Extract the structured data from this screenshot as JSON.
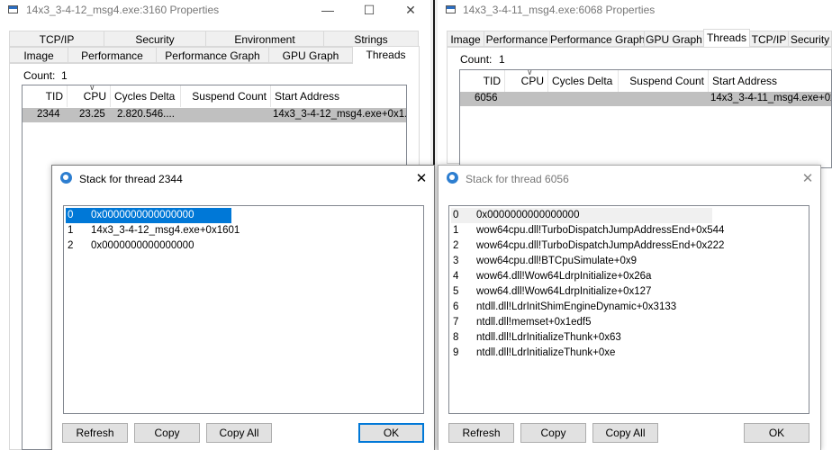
{
  "left_window": {
    "title": "14x3_3-4-12_msg4.exe:3160 Properties",
    "tabs_row1": [
      "TCP/IP",
      "Security",
      "Environment",
      "Strings"
    ],
    "tabs_row2": [
      "Image",
      "Performance",
      "Performance Graph",
      "GPU Graph",
      "Threads"
    ],
    "active_tab": "Threads",
    "count_label": "Count:",
    "count_value": "1",
    "columns": [
      "TID",
      "CPU",
      "Cycles Delta",
      "Suspend Count",
      "Start Address"
    ],
    "row": {
      "tid": "2344",
      "cpu": "23.25",
      "cycles": "2.820.546....",
      "suspend": "",
      "start": "14x3_3-4-12_msg4.exe+0x1..."
    }
  },
  "right_window": {
    "title": "14x3_3-4-11_msg4.exe:6068 Properties",
    "tabs": [
      "Image",
      "Performance",
      "Performance Graph",
      "GPU Graph",
      "Threads",
      "TCP/IP",
      "Security"
    ],
    "active_tab": "Threads",
    "count_label": "Count:",
    "count_value": "1",
    "columns": [
      "TID",
      "CPU",
      "Cycles Delta",
      "Suspend Count",
      "Start Address"
    ],
    "row": {
      "tid": "6056",
      "cpu": "",
      "cycles": "",
      "suspend": "",
      "start": "14x3_3-4-11_msg4.exe+0x1..."
    }
  },
  "left_dialog": {
    "title": "Stack for thread 2344",
    "frames": [
      {
        "n": "0",
        "addr": "0x0000000000000000"
      },
      {
        "n": "1",
        "addr": "14x3_3-4-12_msg4.exe+0x1601"
      },
      {
        "n": "2",
        "addr": "0x0000000000000000"
      }
    ],
    "buttons": {
      "refresh": "Refresh",
      "copy": "Copy",
      "copy_all": "Copy All",
      "ok": "OK"
    }
  },
  "right_dialog": {
    "title": "Stack for thread 6056",
    "frames": [
      {
        "n": "0",
        "addr": "0x0000000000000000"
      },
      {
        "n": "1",
        "addr": "wow64cpu.dll!TurboDispatchJumpAddressEnd+0x544"
      },
      {
        "n": "2",
        "addr": "wow64cpu.dll!TurboDispatchJumpAddressEnd+0x222"
      },
      {
        "n": "3",
        "addr": "wow64cpu.dll!BTCpuSimulate+0x9"
      },
      {
        "n": "4",
        "addr": "wow64.dll!Wow64LdrpInitialize+0x26a"
      },
      {
        "n": "5",
        "addr": "wow64.dll!Wow64LdrpInitialize+0x127"
      },
      {
        "n": "6",
        "addr": "ntdll.dll!LdrInitShimEngineDynamic+0x3133"
      },
      {
        "n": "7",
        "addr": "ntdll.dll!memset+0x1edf5"
      },
      {
        "n": "8",
        "addr": "ntdll.dll!LdrInitializeThunk+0x63"
      },
      {
        "n": "9",
        "addr": "ntdll.dll!LdrInitializeThunk+0xe"
      }
    ],
    "buttons": {
      "refresh": "Refresh",
      "copy": "Copy",
      "copy_all": "Copy All",
      "ok": "OK"
    }
  },
  "icons": {
    "minimize": "minimize-icon",
    "maximize": "maximize-icon",
    "close": "close-icon",
    "sort": "sort-indicator-icon"
  },
  "colors": {
    "selection": "#0078d7",
    "row_highlight": "#c0c0c0",
    "inactive_text": "#777777",
    "border": "#d9d9d9"
  }
}
